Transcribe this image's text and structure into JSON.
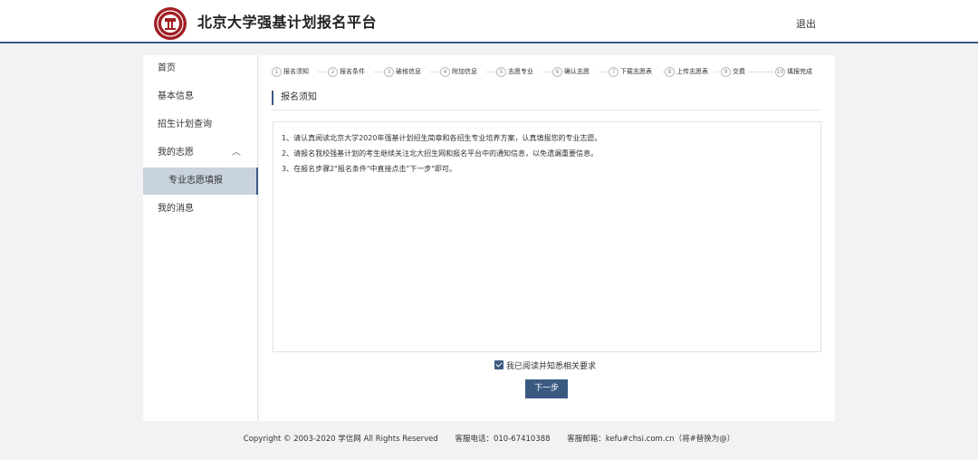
{
  "header": {
    "title": "北京大学强基计划报名平台",
    "logout_label": "退出",
    "logo": "peking-university-seal-icon"
  },
  "sidebar": {
    "items": [
      {
        "label": "首页"
      },
      {
        "label": "基本信息"
      },
      {
        "label": "招生计划查询"
      },
      {
        "label": "我的志愿",
        "expanded": true
      },
      {
        "label": "专业志愿填报",
        "active": true
      },
      {
        "label": "我的消息"
      }
    ]
  },
  "steps": [
    {
      "num": "1",
      "label": "报名须知"
    },
    {
      "num": "2",
      "label": "报名条件"
    },
    {
      "num": "3",
      "label": "破格信息"
    },
    {
      "num": "4",
      "label": "附加信息"
    },
    {
      "num": "5",
      "label": "志愿专业"
    },
    {
      "num": "6",
      "label": "确认志愿"
    },
    {
      "num": "7",
      "label": "下载志愿表"
    },
    {
      "num": "8",
      "label": "上传志愿表"
    },
    {
      "num": "9",
      "label": "交费"
    },
    {
      "num": "10",
      "label": "填报完成"
    }
  ],
  "main": {
    "section_title": "报名须知",
    "notice_lines": [
      "1、请认真阅读北京大学2020年强基计划招生简章和各招生专业培养方案，认真填报您的专业志愿。",
      "2、请报名我校强基计划的考生继续关注北大招生网和报名平台中的通知信息，以免遗漏重要信息。",
      "3、在报名步骤2\"报名条件\"中直接点击\"下一步\"即可。"
    ],
    "agree_label": "我已阅读并知悉相关要求",
    "agree_checked": true,
    "next_label": "下一步"
  },
  "footer": {
    "copyright": "Copyright © 2003-2020 学信网 All Rights Reserved",
    "phone": "客服电话：010-67410388",
    "email": "客服邮箱：kefu#chsi.com.cn（将#替换为@）"
  },
  "colors": {
    "accent": "#3b5a82",
    "logo_red": "#a01f24",
    "active_bg": "#c9d3dd",
    "page_bg": "#f2f2f4"
  }
}
